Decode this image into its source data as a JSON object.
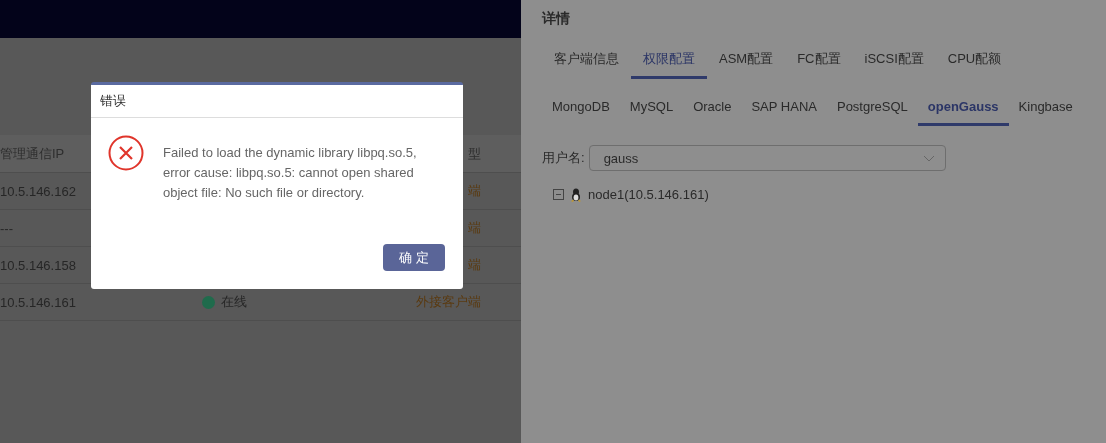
{
  "table": {
    "columns": [
      "管理通信IP",
      "型"
    ],
    "rows": [
      {
        "ip": "10.5.146.162",
        "type": "端"
      },
      {
        "ip": "---",
        "type": "端"
      },
      {
        "ip": "10.5.146.158",
        "type": "端"
      },
      {
        "ip": "10.5.146.161",
        "status": "在线",
        "online": true,
        "type": "外接客户端"
      }
    ]
  },
  "dialog": {
    "title": "错误",
    "kind": "error",
    "message": "Failed to load the dynamic library libpq.so.5, error cause: libpq.so.5: cannot open shared object file: No such file or directory.",
    "button": "确 定"
  },
  "details": {
    "title": "详情",
    "tabs": [
      {
        "label": "客户端信息",
        "selected": false
      },
      {
        "label": "权限配置",
        "selected": true
      },
      {
        "label": "ASM配置",
        "selected": false
      },
      {
        "label": "FC配置",
        "selected": false
      },
      {
        "label": "iSCSI配置",
        "selected": false
      },
      {
        "label": "CPU配额",
        "selected": false
      }
    ],
    "db_tabs": [
      {
        "label": "MongoDB",
        "selected": false
      },
      {
        "label": "MySQL",
        "selected": false
      },
      {
        "label": "Oracle",
        "selected": false
      },
      {
        "label": "SAP HANA",
        "selected": false
      },
      {
        "label": "PostgreSQL",
        "selected": false
      },
      {
        "label": "openGauss",
        "selected": true
      },
      {
        "label": "Kingbase",
        "selected": false
      }
    ],
    "user_label": "用户名:",
    "user_value": "gauss",
    "tree": [
      {
        "label": "node1(10.5.146.161)",
        "expanded": true
      }
    ]
  }
}
